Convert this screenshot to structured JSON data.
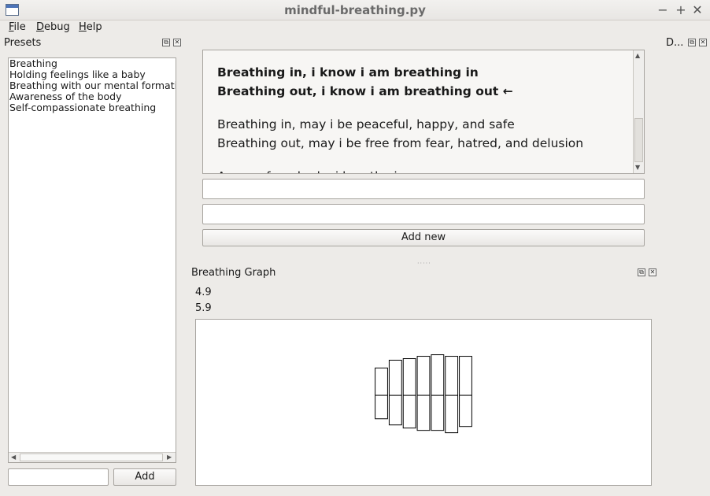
{
  "window": {
    "title": "mindful-breathing.py",
    "minimize": "−",
    "maximize": "+",
    "close": "✕"
  },
  "menu": [
    {
      "label": "File",
      "accel": "F",
      "rest": "ile"
    },
    {
      "label": "Debug",
      "accel": "D",
      "rest": "ebug"
    },
    {
      "label": "Help",
      "accel": "H",
      "rest": "elp"
    }
  ],
  "presets": {
    "title": "Presets",
    "items": [
      "Breathing",
      "Holding feelings like a baby",
      "Breathing with our mental formations",
      "Awareness of the body",
      "Self-compassionate breathing"
    ],
    "input_value": "",
    "add_label": "Add"
  },
  "right_dock": {
    "title": "D..."
  },
  "breathing_phrases": {
    "bold_in": "Breathing in, i know i am breathing in",
    "bold_out": "Breathing out, i know i am breathing out ←",
    "line3": "Breathing in, may i be peaceful, happy, and safe",
    "line4": "Breathing out, may i be free from fear, hatred, and delusion",
    "line5": "Aware of my body, i breathe in"
  },
  "new_phrase": {
    "in_value": "",
    "out_value": "",
    "add_new_label": "Add new"
  },
  "graph": {
    "title": "Breathing Graph",
    "value_in": "4.9",
    "value_out": "5.9",
    "bars": [
      {
        "top": 0.35,
        "bottom": 0.3
      },
      {
        "top": 0.45,
        "bottom": 0.38
      },
      {
        "top": 0.47,
        "bottom": 0.42
      },
      {
        "top": 0.5,
        "bottom": 0.45
      },
      {
        "top": 0.52,
        "bottom": 0.45
      },
      {
        "top": 0.5,
        "bottom": 0.48
      },
      {
        "top": 0.5,
        "bottom": 0.4
      }
    ]
  },
  "icons": {
    "float": "float-icon",
    "close": "close-icon",
    "app": "app-icon"
  }
}
